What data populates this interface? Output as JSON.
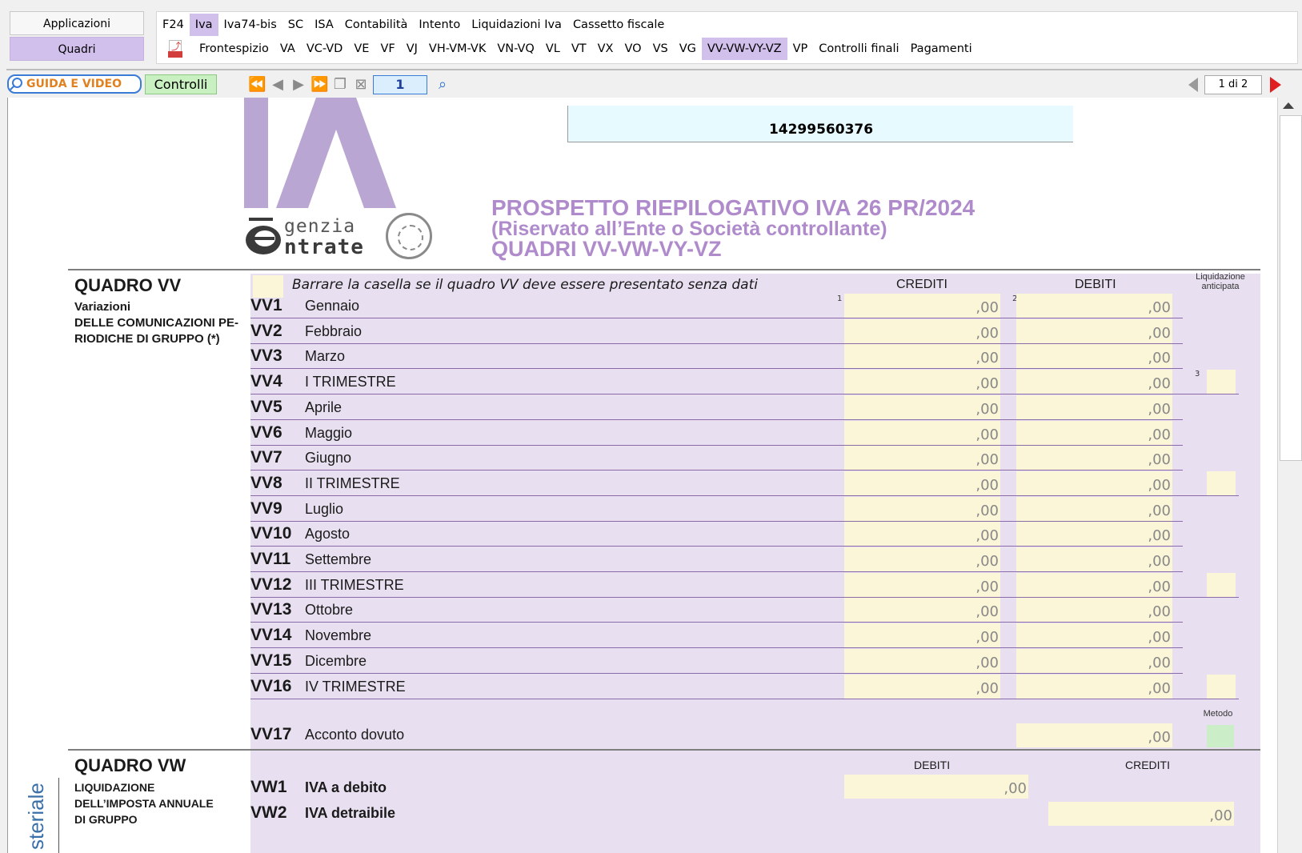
{
  "left_buttons": [
    "Applicazioni",
    "Quadri"
  ],
  "menu_row1": [
    "F24",
    "Iva",
    "Iva74-bis",
    "SC",
    "ISA",
    "Contabilità",
    "Intento",
    "Liquidazioni Iva",
    "Cassetto fiscale"
  ],
  "menu_row1_selected": "Iva",
  "menu_row2": [
    "Frontespizio",
    "VA",
    "VC-VD",
    "VE",
    "VF",
    "VJ",
    "VH-VM-VK",
    "VN-VQ",
    "VL",
    "VT",
    "VX",
    "VO",
    "VS",
    "VG",
    "VV-VW-VY-VZ",
    "VP",
    "Controlli finali",
    "Pagamenti"
  ],
  "menu_row2_selected": "VV-VW-VY-VZ",
  "toolbar": {
    "guida_label": "GUIDA E VIDEO",
    "controlli_label": "Controlli",
    "page_input": "1",
    "page_count": "1 di 2"
  },
  "logo": {
    "line1": "genzia",
    "line2": "ntrate"
  },
  "document": {
    "codice_fiscale": "14299560376",
    "title_line1": "PROSPETTO RIEPILOGATIVO IVA 26 PR/2024",
    "title_line2": "(Riservato all’Ente o Società controllante)",
    "title_line3": "QUADRI VV-VW-VY-VZ",
    "vv": {
      "title": "QUADRO VV",
      "subtitle1": "Variazioni",
      "subtitle2": "DELLE COMUNICAZIONI PE-",
      "subtitle3": "RIODICHE DI GRUPPO (*)",
      "checkbox_label": "Barrare la casella se il quadro VV deve essere presentato senza dati",
      "col_crediti": "CREDITI",
      "col_debiti": "DEBITI",
      "col_liq": "Liquidazione anticipata",
      "col_metodo": "Metodo",
      "sup1": "1",
      "sup2": "2",
      "sup3": "3",
      "rows": [
        {
          "code": "VV1",
          "label": "Gennaio",
          "crediti": ",00",
          "debiti": ",00"
        },
        {
          "code": "VV2",
          "label": "Febbraio",
          "crediti": ",00",
          "debiti": ",00"
        },
        {
          "code": "VV3",
          "label": "Marzo",
          "crediti": ",00",
          "debiti": ",00"
        },
        {
          "code": "VV4",
          "label": "I TRIMESTRE",
          "crediti": ",00",
          "debiti": ",00"
        },
        {
          "code": "VV5",
          "label": "Aprile",
          "crediti": ",00",
          "debiti": ",00"
        },
        {
          "code": "VV6",
          "label": "Maggio",
          "crediti": ",00",
          "debiti": ",00"
        },
        {
          "code": "VV7",
          "label": "Giugno",
          "crediti": ",00",
          "debiti": ",00"
        },
        {
          "code": "VV8",
          "label": "II TRIMESTRE",
          "crediti": ",00",
          "debiti": ",00"
        },
        {
          "code": "VV9",
          "label": "Luglio",
          "crediti": ",00",
          "debiti": ",00"
        },
        {
          "code": "VV10",
          "label": "Agosto",
          "crediti": ",00",
          "debiti": ",00"
        },
        {
          "code": "VV11",
          "label": "Settembre",
          "crediti": ",00",
          "debiti": ",00"
        },
        {
          "code": "VV12",
          "label": "III TRIMESTRE",
          "crediti": ",00",
          "debiti": ",00"
        },
        {
          "code": "VV13",
          "label": "Ottobre",
          "crediti": ",00",
          "debiti": ",00"
        },
        {
          "code": "VV14",
          "label": "Novembre",
          "crediti": ",00",
          "debiti": ",00"
        },
        {
          "code": "VV15",
          "label": "Dicembre",
          "crediti": ",00",
          "debiti": ",00"
        },
        {
          "code": "VV16",
          "label": "IV TRIMESTRE",
          "crediti": ",00",
          "debiti": ",00"
        }
      ],
      "vv17": {
        "code": "VV17",
        "label": "Acconto dovuto",
        "value": ",00"
      }
    },
    "vw": {
      "title": "QUADRO VW",
      "subtitle1": "LIQUIDAZIONE",
      "subtitle2": "DELL’IMPOSTA ANNUALE",
      "subtitle3": "DI GRUPPO",
      "col_debiti": "DEBITI",
      "col_crediti": "CREDITI",
      "rows": [
        {
          "code": "VW1",
          "label": "IVA a debito",
          "value": ",00"
        },
        {
          "code": "VW2",
          "label": "IVA detraibile",
          "value": ",00"
        }
      ]
    },
    "vertical_label": "steriale"
  }
}
